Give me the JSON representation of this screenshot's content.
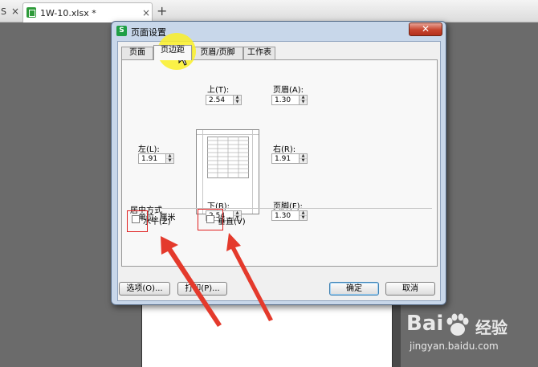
{
  "tabbar": {
    "prev_tab": "S",
    "active_tab": "1W-10.xlsx *",
    "close": "×",
    "add": "+"
  },
  "dialog": {
    "title": "页面设置",
    "logo_letter": "S",
    "close_glyph": "✕",
    "tabs": [
      "页面",
      "页边距",
      "页眉/页脚",
      "工作表"
    ],
    "active_tab": "页边距",
    "top": {
      "label": "上(T):",
      "value": "2.54"
    },
    "header": {
      "label": "页眉(A):",
      "value": "1.30"
    },
    "left": {
      "label": "左(L):",
      "value": "1.91"
    },
    "right": {
      "label": "右(R):",
      "value": "1.91"
    },
    "bottom": {
      "label": "下(B):",
      "value": "2.54"
    },
    "footer": {
      "label": "页脚(F):",
      "value": "1.30"
    },
    "unit": "单位: 厘米",
    "center_group": "居中方式",
    "horizontal": {
      "label": "水平(Z)",
      "checked": false
    },
    "vertical": {
      "label": "垂直(V)",
      "checked": false
    },
    "buttons": {
      "options": "选项(O)...",
      "print": "打印(P)...",
      "ok": "确定",
      "cancel": "取消"
    }
  },
  "watermark": {
    "logo": "Bai",
    "brand": "经验",
    "url": "jingyan.baidu.com"
  },
  "colors": {
    "annotation_red": "#e02020",
    "highlight_yellow": "#faf028",
    "dialog_frame": "#c8d7ea"
  }
}
